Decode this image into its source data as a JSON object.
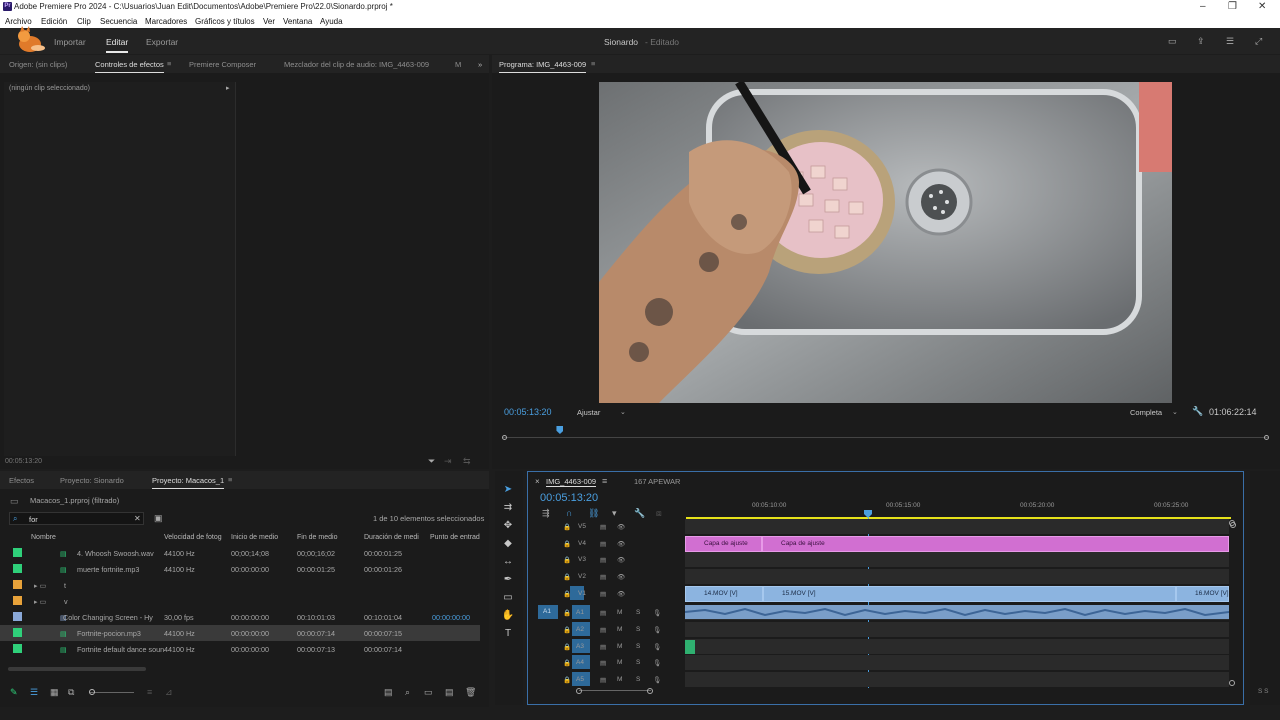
{
  "window": {
    "title": "Adobe Premiere Pro 2024 - C:\\Usuarios\\Juan Edit\\Documentos\\Adobe\\Premiere Pro\\22.0\\Sionardo.prproj *"
  },
  "menu": [
    "Archivo",
    "Edición",
    "Clip",
    "Secuencia",
    "Marcadores",
    "Gráficos y títulos",
    "Ver",
    "Ventana",
    "Ayuda"
  ],
  "header": {
    "workspaces": [
      "Importar",
      "Editar",
      "Exportar"
    ],
    "project_name": "Sionardo",
    "project_state": "- Editado"
  },
  "source_panel": {
    "tabs": [
      "Origen: (sin clips)",
      "Controles de efectos",
      "Premiere Composer",
      "Mezclador del clip de audio: IMG_4463-009",
      "M"
    ],
    "no_clip": "(ningún clip seleccionado)",
    "timecode": "00:05:13:20"
  },
  "program_panel": {
    "tab": "Programa: IMG_4463-009",
    "timecode": "00:05:13:20",
    "fit": "Ajustar",
    "quality": "Completa",
    "duration": "01:06:22:14",
    "playhead_fraction": 0.075
  },
  "project_panel": {
    "tabs": [
      "Efectos",
      "Proyecto: Sionardo",
      "Proyecto: Macacos_1"
    ],
    "path": "Macacos_1.prproj (filtrado)",
    "search": "for",
    "selection_info": "1 de 10 elementos seleccionados",
    "columns": [
      "Nombre",
      "Velocidad de fotog",
      "Inicio de medio",
      "Fin de medio",
      "Duración de medi",
      "Punto de entrad"
    ],
    "rows": [
      {
        "name": "4. Whoosh Swoosh.wav",
        "rate": "44100 Hz",
        "start": "00;00;14;08",
        "end": "00;00;16;02",
        "dur": "00:00:01:25",
        "in": "",
        "color": "#2fd07a",
        "type": "audio"
      },
      {
        "name": "muerte fortnite.mp3",
        "rate": "44100 Hz",
        "start": "00:00:00:00",
        "end": "00:00:01:25",
        "dur": "00:00:01:26",
        "in": "",
        "color": "#2fd07a",
        "type": "audio"
      },
      {
        "name": "t",
        "rate": "",
        "start": "",
        "end": "",
        "dur": "",
        "in": "",
        "color": "#e8a23a",
        "type": "folder"
      },
      {
        "name": "v",
        "rate": "",
        "start": "",
        "end": "",
        "dur": "",
        "in": "",
        "color": "#e8a23a",
        "type": "folder"
      },
      {
        "name": "Color Changing Screen - Hy",
        "rate": "30,00 fps",
        "start": "00:00:00:00",
        "end": "00:10:01:03",
        "dur": "00:10:01:04",
        "in": "00:00:00:00",
        "color": "#8aa8d8",
        "type": "video"
      },
      {
        "name": "Fortnite-pocion.mp3",
        "rate": "44100 Hz",
        "start": "00:00:00:00",
        "end": "00:00:07:14",
        "dur": "00:00:07:15",
        "in": "",
        "color": "#2fd07a",
        "type": "audio",
        "selected": true
      },
      {
        "name": "Fortnite default dance soun",
        "rate": "44100 Hz",
        "start": "00:00:00:00",
        "end": "00:00:07:13",
        "dur": "00:00:07:14",
        "in": "",
        "color": "#2fd07a",
        "type": "audio"
      }
    ]
  },
  "timeline": {
    "tabs": [
      "IMG_4463-009",
      "167 APEWAR"
    ],
    "timecode": "00:05:13:20",
    "ruler": [
      "00:05:10:00",
      "00:05:15:00",
      "00:05:20:00",
      "00:05:25:00"
    ],
    "video_tracks": [
      "V5",
      "V4",
      "V3",
      "V2",
      "V1"
    ],
    "audio_tracks": [
      "A1",
      "A2",
      "A3",
      "A4",
      "A5"
    ],
    "clips": {
      "adj1": "Capa de ajuste",
      "adj2": "Capa de ajuste",
      "v1a": "14.MOV [V]",
      "v1b": "15.MOV [V]",
      "v1c": "16.MOV [V]"
    },
    "src_a1": "A1",
    "src_v1": "V1",
    "meter": "S S"
  },
  "colors": {
    "accent": "#4a9fe0",
    "timecode": "#4a9fe0"
  }
}
